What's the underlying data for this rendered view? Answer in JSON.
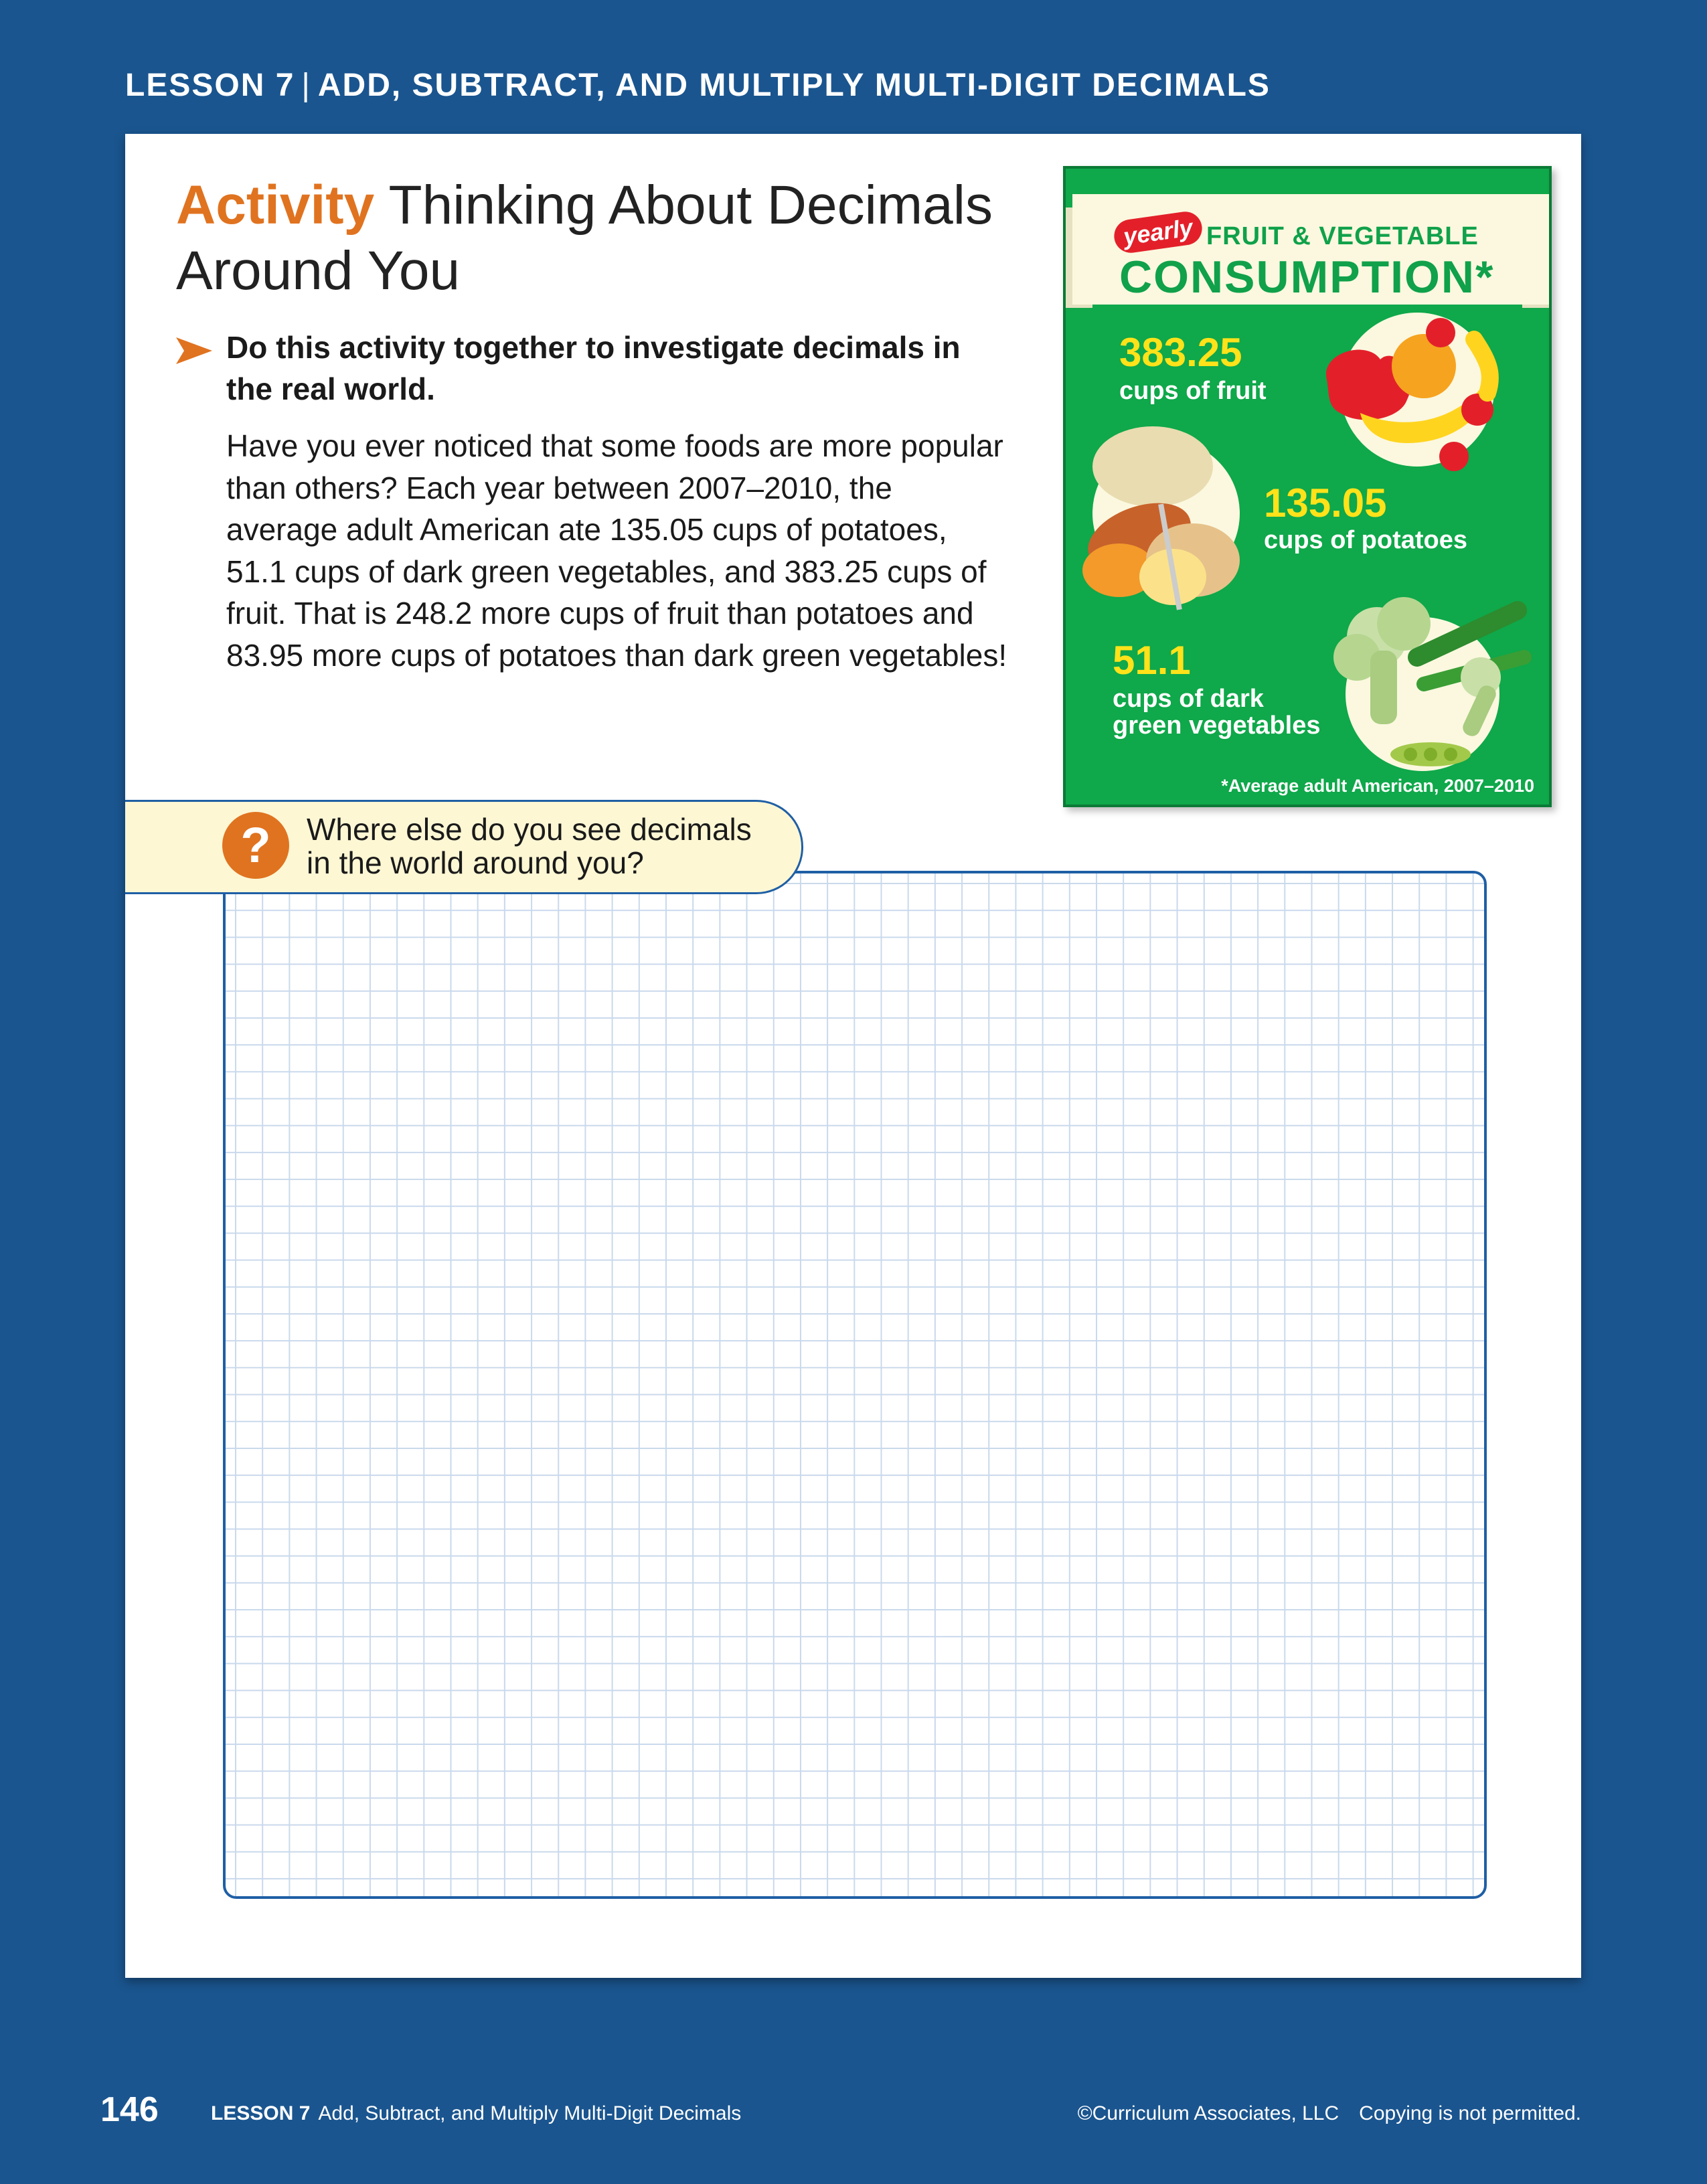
{
  "header": {
    "lesson": "LESSON 7",
    "separator": "|",
    "title": "ADD, SUBTRACT, AND MULTIPLY MULTI-DIGIT DECIMALS"
  },
  "activity": {
    "keyword": "Activity",
    "title": "Thinking About Decimals Around You",
    "instruction": "Do this activity together to investigate decimals in the real world.",
    "body": "Have you ever noticed that some foods are more popular than others? Each year between 2007–2010, the average adult American ate 135.05 cups of potatoes, 51.1 cups of dark green vegetables, and 383.25 cups of fruit. That is 248.2 more cups of fruit than potatoes and 83.95 more cups of potatoes than dark green vegetables!"
  },
  "infographic": {
    "tag": "yearly",
    "heading_line1": "FRUIT & VEGETABLE",
    "heading_line2": "CONSUMPTION*",
    "stats": [
      {
        "value": "383.25",
        "label": "cups of fruit"
      },
      {
        "value": "135.05",
        "label": "cups of potatoes"
      },
      {
        "value": "51.1",
        "label_line1": "cups of dark",
        "label_line2": "green vegetables"
      }
    ],
    "footnote": "*Average adult American, 2007–2010",
    "colors": {
      "background": "#0fa84a",
      "value": "#ffe21a",
      "tag": "#e3202a"
    }
  },
  "prompt": {
    "icon": "question-icon",
    "symbol": "?",
    "line1": "Where else do you see decimals",
    "line2": "in the world around you?"
  },
  "footer": {
    "page_number": "146",
    "lesson": "LESSON 7",
    "lesson_title": "Add, Subtract, and Multiply Multi-Digit Decimals",
    "copyright": "©Curriculum Associates, LLC",
    "notice": "Copying is not permitted."
  }
}
